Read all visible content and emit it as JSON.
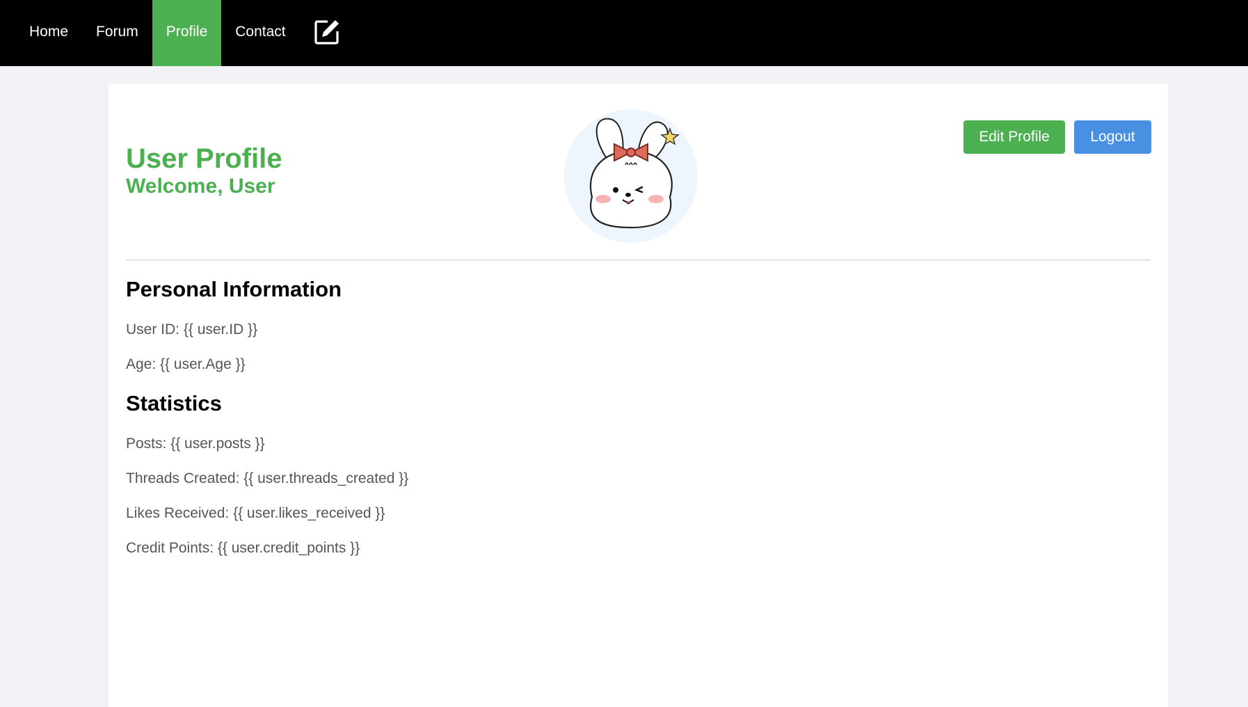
{
  "nav": {
    "items": [
      {
        "label": "Home"
      },
      {
        "label": "Forum"
      },
      {
        "label": "Profile"
      },
      {
        "label": "Contact"
      }
    ],
    "active": "Profile",
    "compose_icon": "edit-icon"
  },
  "header": {
    "title": "User Profile",
    "subtitle": "Welcome, User",
    "avatar_icon": "bunny-avatar-icon",
    "edit_label": "Edit Profile",
    "logout_label": "Logout"
  },
  "personal": {
    "heading": "Personal Information",
    "user_id": "User ID: {{ user.ID }}",
    "age": "Age: {{ user.Age }}"
  },
  "stats": {
    "heading": "Statistics",
    "posts": "Posts: {{ user.posts }}",
    "threads": "Threads Created: {{ user.threads_created }}",
    "likes": "Likes Received: {{ user.likes_received }}",
    "credits": "Credit Points: {{ user.credit_points }}"
  },
  "colors": {
    "nav_bg": "#000000",
    "accent_green": "#4caf50",
    "accent_blue": "#4a90e2",
    "page_bg": "#f0f2f5"
  }
}
